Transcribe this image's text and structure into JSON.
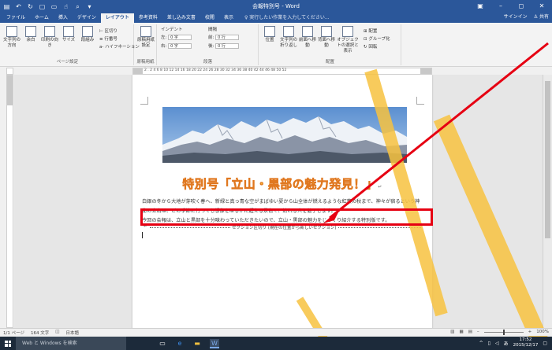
{
  "titlebar": {
    "title": "会報特別号 - Word",
    "qat": [
      "save-icon",
      "undo-icon",
      "redo-icon",
      "new-doc-icon",
      "open-icon",
      "touch-mode-icon",
      "print-preview-icon",
      "customize-icon"
    ]
  },
  "tabs": [
    "ファイル",
    "ホーム",
    "挿入",
    "デザイン",
    "レイアウト",
    "参考資料",
    "差し込み文書",
    "校閲",
    "表示"
  ],
  "active_tab": "レイアウト",
  "tellme": "実行したい作業を入力してください...",
  "account": {
    "signin": "サインイン",
    "share": "共有"
  },
  "ribbon": {
    "page_setup": {
      "label": "ページ設定",
      "buttons": [
        "文字列の方向",
        "余白",
        "印刷の向き",
        "サイズ",
        "段組み"
      ],
      "small": [
        "区切り",
        "行番号",
        "ハイフネーション"
      ]
    },
    "manuscript": {
      "label": "原稿用紙",
      "button": "原稿用紙設定"
    },
    "paragraph": {
      "label": "段落",
      "indent_label": "インデント",
      "spacing_label": "間隔",
      "left_label": "左:",
      "left_value": "0 字",
      "right_label": "右:",
      "right_value": "0 字",
      "before_label": "前:",
      "before_value": "0 行",
      "after_label": "後:",
      "after_value": "0 行"
    },
    "arrange": {
      "label": "配置",
      "buttons": [
        "位置",
        "文字列の折り返し",
        "前面へ移動",
        "背面へ移動",
        "オブジェクトの選択と表示"
      ],
      "small": [
        "配置",
        "グループ化",
        "回転"
      ]
    }
  },
  "ruler": {
    "numbers": "2  .  2  4  6  8  10  12  14  16  18  20  22  24  26  28  30  32  34  36  38  40  42  44  46  48  50  52"
  },
  "document": {
    "heading": "特別号「立山・黒部の魅力発見！」",
    "paragraph": "白銀の冬から大地が芽吹く春へ、新緑と真っ青な空がまばゆい夏から山全体が燃えるような紅葉の秋まで、神々が宿るという神秘の立山は、どの季節に行っても想像をはるかに超える景色で、訪れる人を魅了します。\n今回の会報は、立山と黒部を十分味わっていただきたいので、立山・黒部の魅力をじっくり紹介する特別版です。",
    "section_break": "セクション区切り (現在の位置から新しいセクション)",
    "paragraph_mark": "↵"
  },
  "statusbar": {
    "page": "1/1 ページ",
    "words": "164 文字",
    "lang": "日本語",
    "zoom": "100%"
  },
  "taskbar": {
    "search": "Web と Windows を検索",
    "time": "17:52",
    "date": "2015/12/17"
  },
  "colors": {
    "title_blue": "#2b579a",
    "heading_orange": "#f5b638",
    "annotation_red": "#e60012",
    "watermark_yellow": "#f7c23f"
  }
}
